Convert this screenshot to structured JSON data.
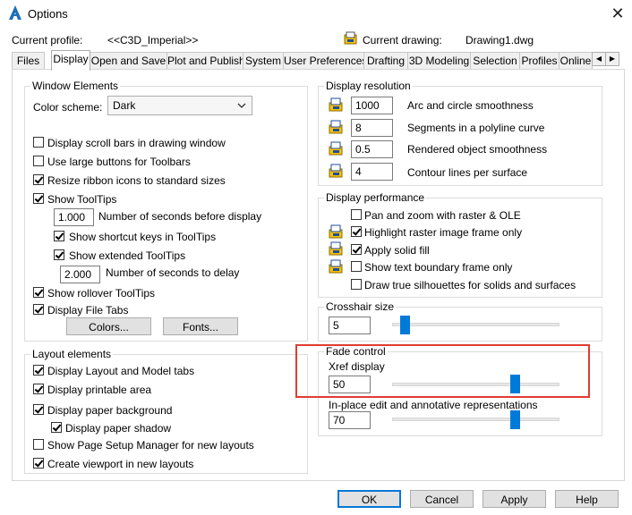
{
  "window": {
    "title": "Options",
    "close_glyph": "✕"
  },
  "header": {
    "profile_label": "Current profile:",
    "profile_value": "<<C3D_Imperial>>",
    "drawing_label": "Current drawing:",
    "drawing_value": "Drawing1.dwg"
  },
  "tabs": [
    "Files",
    "Display",
    "Open and Save",
    "Plot and Publish",
    "System",
    "User Preferences",
    "Drafting",
    "3D Modeling",
    "Selection",
    "Profiles",
    "Online"
  ],
  "active_tab": "Display",
  "window_elements": {
    "title": "Window Elements",
    "color_scheme_label": "Color scheme:",
    "color_scheme_value": "Dark",
    "checks": {
      "scroll_bars": "Display scroll bars in drawing window",
      "large_buttons": "Use large buttons for Toolbars",
      "resize_ribbon": "Resize ribbon icons to standard sizes",
      "show_tooltips": "Show ToolTips",
      "shortcut_keys": "Show shortcut keys in ToolTips",
      "extended_tooltips": "Show extended ToolTips",
      "rollover": "Show rollover ToolTips",
      "file_tabs": "Display File Tabs"
    },
    "seconds_before_value": "1.000",
    "seconds_before_label": "Number of seconds before display",
    "seconds_delay_value": "2.000",
    "seconds_delay_label": "Number of seconds to delay",
    "colors_button": "Colors...",
    "fonts_button": "Fonts..."
  },
  "layout_elements": {
    "title": "Layout elements",
    "checks": {
      "layout_model_tabs": "Display Layout and Model tabs",
      "printable_area": "Display printable area",
      "paper_background": "Display paper background",
      "paper_shadow": "Display paper shadow",
      "page_setup": "Show Page Setup Manager for new layouts",
      "viewport": "Create viewport in new layouts"
    }
  },
  "display_resolution": {
    "title": "Display resolution",
    "arc_value": "1000",
    "arc_label": "Arc and circle smoothness",
    "segments_value": "8",
    "segments_label": "Segments in a polyline curve",
    "rendered_value": "0.5",
    "rendered_label": "Rendered object smoothness",
    "contour_value": "4",
    "contour_label": "Contour lines per surface"
  },
  "display_performance": {
    "title": "Display performance",
    "pan_zoom": "Pan and zoom with raster & OLE",
    "highlight_raster": "Highlight raster image frame only",
    "solid_fill": "Apply solid fill",
    "text_boundary": "Show text boundary frame only",
    "silhouettes": "Draw true silhouettes for solids and surfaces"
  },
  "crosshair": {
    "title": "Crosshair size",
    "value": "5",
    "level": 0.05
  },
  "fade_control": {
    "title": "Fade control",
    "xref_label": "Xref display",
    "xref_value": "50",
    "xref_level": 0.75,
    "inplace_label": "In-place edit and annotative representations",
    "inplace_value": "70",
    "inplace_level": 0.75
  },
  "footer": {
    "ok": "OK",
    "cancel": "Cancel",
    "apply": "Apply",
    "help": "Help"
  },
  "colors": {
    "accent": "#0078d7",
    "slider_thumb": "#007ad9",
    "highlight_box": "#e03c31",
    "sys_icon_yellow": "#f4c20d",
    "sys_icon_blue": "#1f4e9c"
  }
}
